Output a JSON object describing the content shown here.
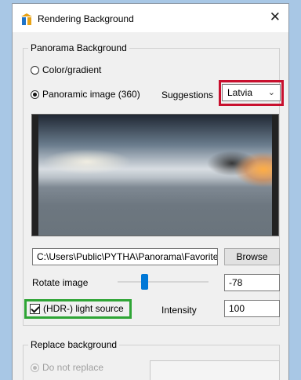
{
  "window": {
    "title": "Rendering Background",
    "close_glyph": "✕"
  },
  "panorama_group": {
    "label": "Panorama Background",
    "option_color": "Color/gradient",
    "option_panoramic": "Panoramic image (360)",
    "selected": "Panoramic image (360)",
    "suggestions_label": "Suggestions",
    "suggestions_value": "Latvia",
    "path_value": "C:\\Users\\Public\\PYTHA\\Panorama\\Favorite",
    "browse_label": "Browse",
    "rotate_label": "Rotate image",
    "rotate_value": "-78",
    "hdr_label": "(HDR-) light source",
    "hdr_checked": true,
    "intensity_label": "Intensity",
    "intensity_value": "100"
  },
  "replace_group": {
    "label": "Replace background",
    "option_do_not_replace": "Do not replace"
  },
  "colors": {
    "highlight_red": "#c8102e",
    "highlight_green": "#2fa536",
    "accent": "#0078d7"
  }
}
